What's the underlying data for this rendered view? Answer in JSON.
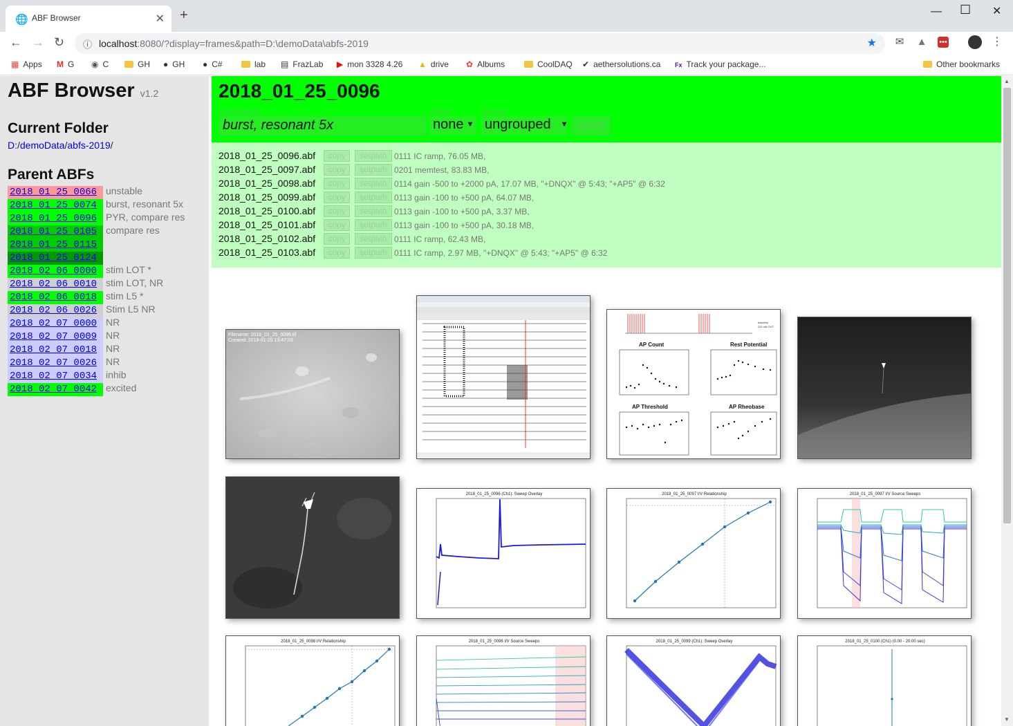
{
  "browser": {
    "tab_title": "ABF Browser",
    "url_host": "localhost",
    "url_rest": ":8080/?display=frames&path=D:\\demoData\\abfs-2019",
    "bookmarks": [
      "Apps",
      "G",
      "C",
      "GH",
      "GH",
      "C#",
      "lab",
      "FrazLab",
      "mon 3328 4.26",
      "drive",
      "Albums",
      "CoolDAQ",
      "aethersolutions.ca",
      "Track your package...",
      "Other bookmarks"
    ]
  },
  "sidebar": {
    "title": "ABF Browser",
    "version": "v1.2",
    "current_folder_heading": "Current Folder",
    "path": {
      "drive": "D:",
      "sep1": "/",
      "dir1": "demoData",
      "sep2": "/",
      "dir2": "abfs-2019",
      "sep3": "/"
    },
    "parent_heading": "Parent ABFs",
    "parents": [
      {
        "id": "2018_01_25_0066",
        "note": "unstable",
        "color": "#ff9999"
      },
      {
        "id": "2018_01_25_0074",
        "note": "burst, resonant 5x",
        "color": "#00ff00"
      },
      {
        "id": "2018_01_25_0096",
        "note": "PYR, compare res",
        "color": "#00ff00"
      },
      {
        "id": "2018_01_25_0105",
        "note": "compare res",
        "color": "#00cc00"
      },
      {
        "id": "2018_01_25_0115",
        "note": "",
        "color": "#00cc00"
      },
      {
        "id": "2018_01_25_0124",
        "note": "",
        "color": "#009900"
      },
      {
        "id": "2018_02_06_0000",
        "note": "stim LOT *",
        "color": "#00ff00"
      },
      {
        "id": "2018_02_06_0010",
        "note": "stim LOT, NR",
        "color": "#cfcfcf"
      },
      {
        "id": "2018_02_06_0018",
        "note": "stim L5 *",
        "color": "#00ff00"
      },
      {
        "id": "2018_02_06_0026",
        "note": "Stim L5 NR",
        "color": "#cfcfcf"
      },
      {
        "id": "2018_02_07_0000",
        "note": "NR",
        "color": "#ccccff"
      },
      {
        "id": "2018_02_07_0009",
        "note": "NR",
        "color": "#ccccff"
      },
      {
        "id": "2018_02_07_0018",
        "note": "NR",
        "color": "#ccccff"
      },
      {
        "id": "2018_02_07_0026",
        "note": "NR",
        "color": "#ccccff"
      },
      {
        "id": "2018_02_07_0034",
        "note": "inhib",
        "color": "#ccccff"
      },
      {
        "id": "2018_02_07_0042",
        "note": "excited",
        "color": "#00ff00"
      }
    ]
  },
  "header": {
    "title": "2018_01_25_0096",
    "comment_label": "comment:",
    "comment_value": "burst, resonant 5x",
    "color_label": "color:",
    "color_value": "none",
    "group_label": "group:",
    "group_value": "ungrouped",
    "save_label": "save"
  },
  "files": [
    {
      "name": "2018_01_25_0096.abf",
      "copy": "copy",
      "setpath": "setpath",
      "desc": "0111 IC ramp, 76.05 MB,"
    },
    {
      "name": "2018_01_25_0097.abf",
      "copy": "copy",
      "setpath": "setpath",
      "desc": "0201 memtest, 83.83 MB,"
    },
    {
      "name": "2018_01_25_0098.abf",
      "copy": "copy",
      "setpath": "setpath",
      "desc": "0114 gain -500 to +2000 pA, 17.07 MB, \"+DNQX\" @ 5:43; \"+AP5\" @ 6:32"
    },
    {
      "name": "2018_01_25_0099.abf",
      "copy": "copy",
      "setpath": "setpath",
      "desc": "0113 gain -100 to +500 pA, 64.07 MB,"
    },
    {
      "name": "2018_01_25_0100.abf",
      "copy": "copy",
      "setpath": "setpath",
      "desc": "0113 gain -100 to +500 pA, 3.37 MB,"
    },
    {
      "name": "2018_01_25_0101.abf",
      "copy": "copy",
      "setpath": "setpath",
      "desc": "0113 gain -100 to +500 pA, 30.18 MB,"
    },
    {
      "name": "2018_01_25_0102.abf",
      "copy": "copy",
      "setpath": "setpath",
      "desc": "0111 IC ramp, 62.43 MB,"
    },
    {
      "name": "2018_01_25_0103.abf",
      "copy": "copy",
      "setpath": "setpath",
      "desc": "0111 IC ramp, 2.97 MB, \"+DNQX\" @ 5:43; \"+AP5\" @ 6:32"
    }
  ],
  "thumbs": {
    "micro1_text1": "Filename: 2018_01_25_0096.tif",
    "micro1_text2": "Created: 2018-01-25 13:47:03",
    "ap_legend_a": "baseline",
    "ap_legend_b": "200 nM OXT",
    "ap_panel1": "AP Count",
    "ap_panel2": "Rest Potential",
    "ap_panel3": "AP Threshold",
    "ap_panel4": "AP Rheobase",
    "t5_title": "2018_01_25_0096 (Ch1): Sweep Overlay",
    "t6_title": "2018_01_25_0097 I/V Relationship",
    "t7_title": "2018_01_25_0097 I/V Source Sweeps",
    "t8_title": "2018_01_25_0098 I/V Relationship",
    "t9_title": "2018_01_25_0098 I/V Source Sweeps",
    "t10_title": "2018_01_25_0099 (Ch1): Sweep Overlay",
    "t11_title": "2018_01_25_0100 (Ch1) (0.00 - 20.00 sec)"
  },
  "colors": {
    "header_bg": "#00ff00",
    "files_bg": "#bfffbf",
    "sidebar_bg": "#e5e5e5",
    "link": "#0000ee"
  }
}
